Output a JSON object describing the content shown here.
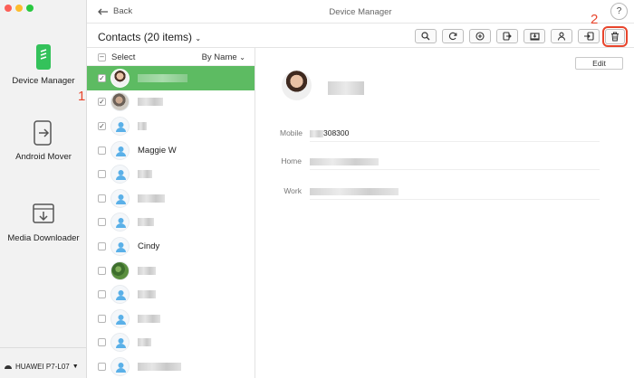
{
  "window": {
    "title": "Device Manager",
    "back_label": "Back",
    "help_label": "?"
  },
  "sidebar": {
    "items": [
      {
        "label": "Device Manager",
        "icon": "phone-icon"
      },
      {
        "label": "Android Mover",
        "icon": "transfer-icon"
      },
      {
        "label": "Media Downloader",
        "icon": "download-icon"
      }
    ],
    "device": {
      "name": "HUAWEI P7-L07",
      "storage_fraction": 0.22
    }
  },
  "toolbar": {
    "contacts_title": "Contacts (20 items)",
    "tools": [
      "search-icon",
      "refresh-icon",
      "add-icon",
      "export-icon",
      "to-computer-icon",
      "contact-icon",
      "to-device-icon",
      "delete-icon"
    ]
  },
  "list": {
    "select_label": "Select",
    "sort_label": "By Name",
    "rows": [
      {
        "name": "",
        "checked": true,
        "selected": true,
        "avatar": "photo1"
      },
      {
        "name": "",
        "checked": true,
        "selected": false,
        "avatar": "photo2"
      },
      {
        "name": "",
        "checked": true,
        "selected": false,
        "avatar": "default"
      },
      {
        "name": "Maggie W",
        "checked": false,
        "selected": false,
        "avatar": "default"
      },
      {
        "name": "",
        "checked": false,
        "selected": false,
        "avatar": "default"
      },
      {
        "name": "",
        "checked": false,
        "selected": false,
        "avatar": "default"
      },
      {
        "name": "",
        "checked": false,
        "selected": false,
        "avatar": "default"
      },
      {
        "name": "Cindy",
        "checked": false,
        "selected": false,
        "avatar": "default"
      },
      {
        "name": "",
        "checked": false,
        "selected": false,
        "avatar": "photo3"
      },
      {
        "name": "",
        "checked": false,
        "selected": false,
        "avatar": "default"
      },
      {
        "name": "",
        "checked": false,
        "selected": false,
        "avatar": "default"
      },
      {
        "name": "",
        "checked": false,
        "selected": false,
        "avatar": "default"
      },
      {
        "name": "",
        "checked": false,
        "selected": false,
        "avatar": "default"
      }
    ]
  },
  "detail": {
    "edit_label": "Edit",
    "fields": [
      {
        "key": "Mobile",
        "value": "308300"
      },
      {
        "key": "Home",
        "value": ""
      },
      {
        "key": "Work",
        "value": ""
      }
    ]
  },
  "annotations": {
    "step1": "1",
    "step2": "2"
  },
  "colors": {
    "selected_row": "#5dbb62",
    "highlight": "#e8452c",
    "storage": "#2ba84a"
  }
}
